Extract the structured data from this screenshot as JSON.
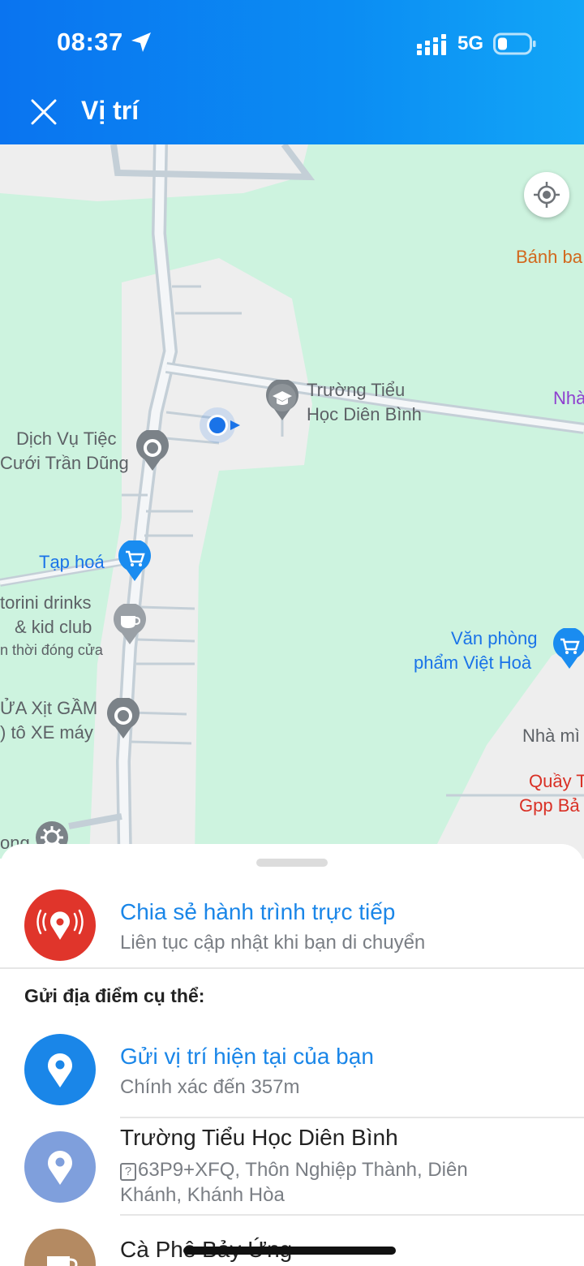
{
  "status_bar": {
    "time": "08:37",
    "network": "5G"
  },
  "header": {
    "title": "Vị trí",
    "close_icon": "close-icon"
  },
  "map": {
    "poi": {
      "banh": "Bánh ba",
      "school_l1": "Trường Tiểu",
      "school_l2": "Học Diên Bình",
      "nha_edge": "Nhà",
      "tiec_l1": "Dịch Vụ Tiệc",
      "tiec_l2": "Cưới Trần Dũng",
      "taphoa": "Tạp hoá",
      "santorini_l1": "torini drinks",
      "santorini_l2": "& kid club",
      "santorini_status": "n thời đóng cửa",
      "vanphong_l1": "Văn phòng",
      "vanphong_l2": "phẩm Việt Hoà",
      "rua_l1": "ỬA Xịt GẦM",
      "rua_l2": ") tô XE máy",
      "nhami": "Nhà mì",
      "quay_l1": "Quầy T",
      "quay_l2": "Gpp Bả",
      "bottom_left": "ong"
    }
  },
  "sheet": {
    "live_share": {
      "title": "Chia sẻ hành trình trực tiếp",
      "subtitle": "Liên tục cập nhật khi bạn di chuyển",
      "color": "#e0352b"
    },
    "section_label": "Gửi địa điểm cụ thể:",
    "current": {
      "title": "Gửi vị trí hiện tại của bạn",
      "subtitle": "Chính xác đến 357m",
      "color": "#1a86e8"
    },
    "school": {
      "title": "Trường Tiểu Học Diên Bình",
      "code_icon": "?",
      "address_l1": "63P9+XFQ, Thôn Nghiệp Thành, Diên",
      "address_l2": "Khánh, Khánh Hòa",
      "color": "#7f9fdc"
    },
    "cafe": {
      "title": "Cà Phê Bảy Ứng",
      "color": "#b48a62"
    }
  }
}
